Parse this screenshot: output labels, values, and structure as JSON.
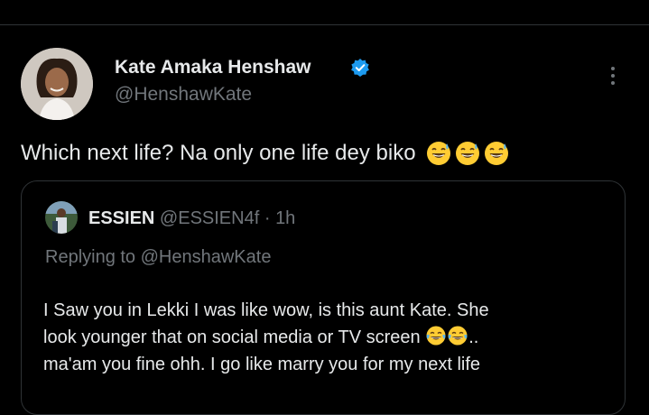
{
  "tweet": {
    "author_name": "Kate Amaka Henshaw",
    "author_handle": "@HenshawKate",
    "text": "Which next life? Na only one life dey biko",
    "emojis": [
      "grinning-sweat-emoji",
      "grinning-sweat-emoji",
      "grinning-sweat-emoji"
    ]
  },
  "quoted": {
    "author_name": "ESSIEN",
    "author_handle": "@ESSIEN4f",
    "separator": "·",
    "time": "1h",
    "replying_to": "Replying to @HenshawKate",
    "line1": "I Saw you in Lekki I was like wow, is this aunt Kate. She",
    "line2_text": "look younger that on social media or TV screen",
    "line2_suffix": "..",
    "line3": "ma'am you fine ohh. I go like marry you for my next life",
    "emojis": [
      "tears-of-joy-emoji",
      "tears-of-joy-emoji"
    ]
  },
  "colors": {
    "background": "#000000",
    "text_primary": "#e7e9ea",
    "text_secondary": "#71767b",
    "border": "#2f3336",
    "verified": "#1d9bf0"
  }
}
